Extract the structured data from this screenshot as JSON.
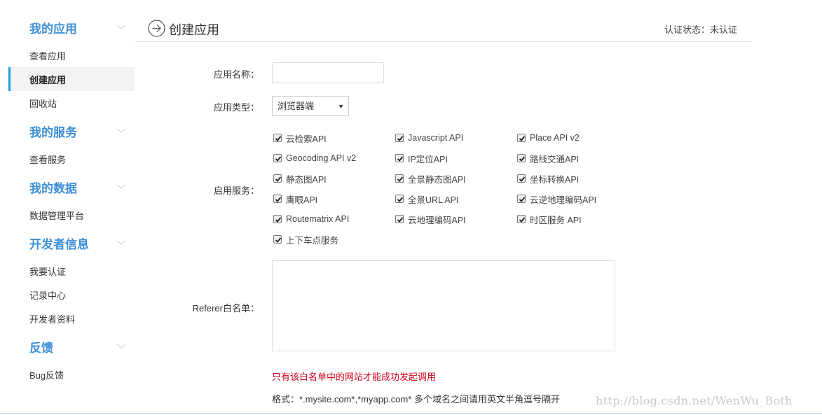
{
  "sidebar": {
    "sections": [
      {
        "title": "我的应用",
        "items": [
          "查看应用",
          "创建应用",
          "回收站"
        ]
      },
      {
        "title": "我的服务",
        "items": [
          "查看服务"
        ]
      },
      {
        "title": "我的数据",
        "items": [
          "数据管理平台"
        ]
      },
      {
        "title": "开发者信息",
        "items": [
          "我要认证",
          "记录中心",
          "开发者资料"
        ]
      },
      {
        "title": "反馈",
        "items": [
          "Bug反馈"
        ]
      }
    ],
    "active_item": "创建应用"
  },
  "header": {
    "title": "创建应用",
    "status": "认证状态：未认证"
  },
  "form": {
    "name_label": "应用名称：",
    "name_value": "",
    "type_label": "应用类型：",
    "type_value": "浏览器端",
    "services_label": "启用服务：",
    "services": [
      {
        "name": "云检索API",
        "checked": true
      },
      {
        "name": "Javascript API",
        "checked": true
      },
      {
        "name": "Place API v2",
        "checked": true
      },
      {
        "name": "Geocoding API v2",
        "checked": true
      },
      {
        "name": "IP定位API",
        "checked": true
      },
      {
        "name": "路线交通API",
        "checked": true
      },
      {
        "name": "静态图API",
        "checked": true
      },
      {
        "name": "全景静态图API",
        "checked": true
      },
      {
        "name": "坐标转换API",
        "checked": true
      },
      {
        "name": "鹰眼API",
        "checked": true
      },
      {
        "name": "全景URL API",
        "checked": true
      },
      {
        "name": "云逆地理编码API",
        "checked": true
      },
      {
        "name": "Routematrix API",
        "checked": true
      },
      {
        "name": "云地理编码API",
        "checked": true
      },
      {
        "name": "时区服务 API",
        "checked": true
      },
      {
        "name": "上下车点服务",
        "checked": true
      }
    ],
    "referer_label": "Referer白名单：",
    "referer_value": "",
    "hint_red": "只有该白名单中的网站才能成功发起调用",
    "hint_format": "格式：*.mysite.com*,*myapp.com* 多个域名之间请用英文半角逗号隔开"
  },
  "watermark": "http://blog.csdn.net/WenWu_Both",
  "colors": {
    "accent": "#3d8fd6",
    "active_bar": "#1e9ee8",
    "warning": "#d0021b"
  }
}
